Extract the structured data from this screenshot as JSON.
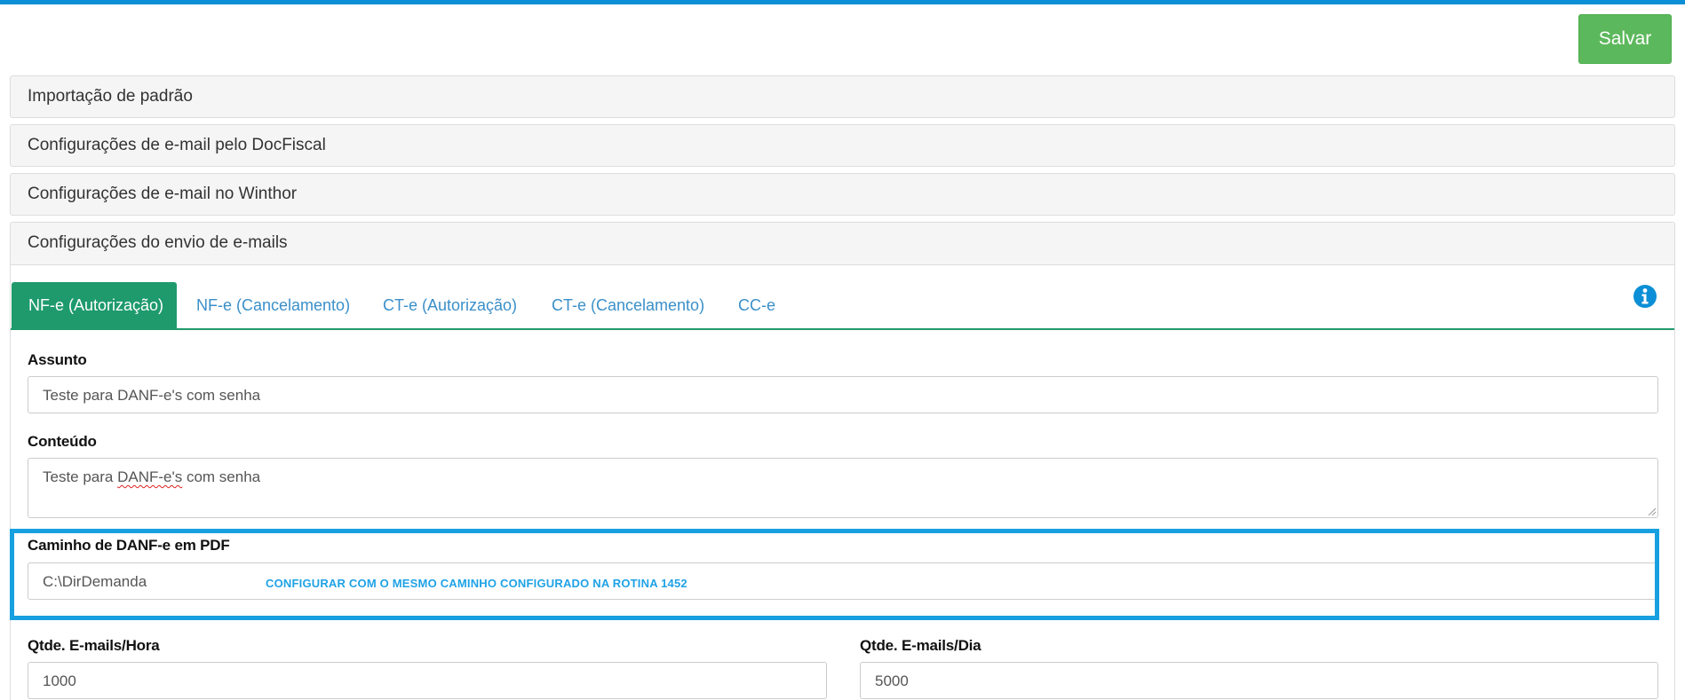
{
  "toolbar": {
    "save_label": "Salvar"
  },
  "panels": [
    {
      "title": "Importação de padrão"
    },
    {
      "title": "Configurações de e-mail pelo DocFiscal"
    },
    {
      "title": "Configurações de e-mail no Winthor"
    },
    {
      "title": "Configurações do envio de e-mails"
    }
  ],
  "tabs": [
    {
      "label": "NF-e (Autorização)",
      "active": true
    },
    {
      "label": "NF-e (Cancelamento)"
    },
    {
      "label": "CT-e (Autorização)"
    },
    {
      "label": "CT-e (Cancelamento)"
    },
    {
      "label": "CC-e"
    }
  ],
  "info_icon": "info-circle-icon",
  "form": {
    "assunto": {
      "label": "Assunto",
      "value": "Teste para DANF-e's com senha"
    },
    "conteudo": {
      "label": "Conteúdo",
      "value_prefix": "Teste para ",
      "value_misspelled": "DANF-e's",
      "value_suffix": " com senha"
    },
    "caminho": {
      "label": "Caminho de DANF-e em PDF",
      "value": "C:\\DirDemanda"
    },
    "emails_hora": {
      "label": "Qtde. E-mails/Hora",
      "value": "1000"
    },
    "emails_dia": {
      "label": "Qtde. E-mails/Dia",
      "value": "5000"
    }
  },
  "annotation": {
    "text": "CONFIGURAR COM O MESMO CAMINHO CONFIGURADO NA ROTINA 1452",
    "color": "#17a0e0"
  },
  "colors": {
    "accent_bar": "#0c8fd6",
    "save_button": "#5cb85c",
    "active_tab": "#1e9a6d",
    "tab_link": "#3a8fc9"
  }
}
